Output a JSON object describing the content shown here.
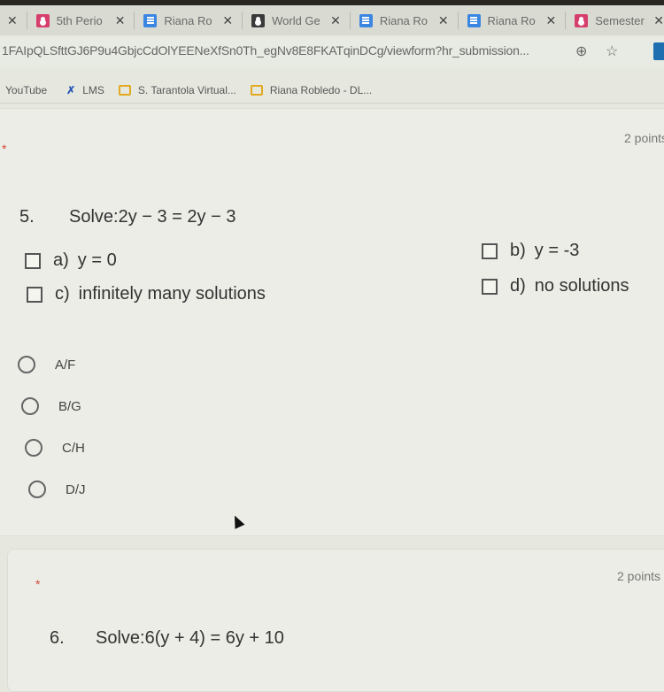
{
  "browser": {
    "tabs": [
      {
        "label": "",
        "icon": "close-only",
        "close": "✕"
      },
      {
        "label": "5th Perio",
        "icon": "classroom-icon",
        "close": "✕"
      },
      {
        "label": "Riana Ro",
        "icon": "docs-icon",
        "close": "✕"
      },
      {
        "label": "World Ge",
        "icon": "classic-icon",
        "close": "✕"
      },
      {
        "label": "Riana Ro",
        "icon": "docs-icon",
        "close": "✕"
      },
      {
        "label": "Riana Ro",
        "icon": "docs-icon",
        "close": "✕"
      },
      {
        "label": "Semester",
        "icon": "classroom-icon",
        "close": "✕"
      }
    ],
    "url": "1FAIpQLSfttGJ6P9u4GbjcCdOlYEENeXfSn0Th_egNv8E8FKATqinDCg/viewform?hr_submission...",
    "omnibox_icons": [
      "zoom-icon",
      "star-icon",
      "extension-icon"
    ],
    "bookmarks": [
      {
        "label": "YouTube",
        "icon": "none"
      },
      {
        "label": "LMS",
        "icon": "lms-icon"
      },
      {
        "label": "S. Tarantola Virtual...",
        "icon": "folder-icon"
      },
      {
        "label": "Riana Robledo - DL...",
        "icon": "folder-icon"
      }
    ]
  },
  "form": {
    "question5": {
      "required_mark": "*",
      "points": "2 points",
      "number": "5.",
      "text": "Solve:2y − 3 = 2y − 3",
      "choices": [
        {
          "letter": "a)",
          "text": "y = 0"
        },
        {
          "letter": "b)",
          "text": "y = -3"
        },
        {
          "letter": "c)",
          "text": "infinitely many solutions"
        },
        {
          "letter": "d)",
          "text": "no solutions"
        }
      ],
      "options": [
        "A/F",
        "B/G",
        "C/H",
        "D/J"
      ],
      "selected": null
    },
    "question6": {
      "required_mark": "*",
      "points": "2 points",
      "number": "6.",
      "text": "Solve:6(y + 4) = 6y + 10"
    }
  }
}
